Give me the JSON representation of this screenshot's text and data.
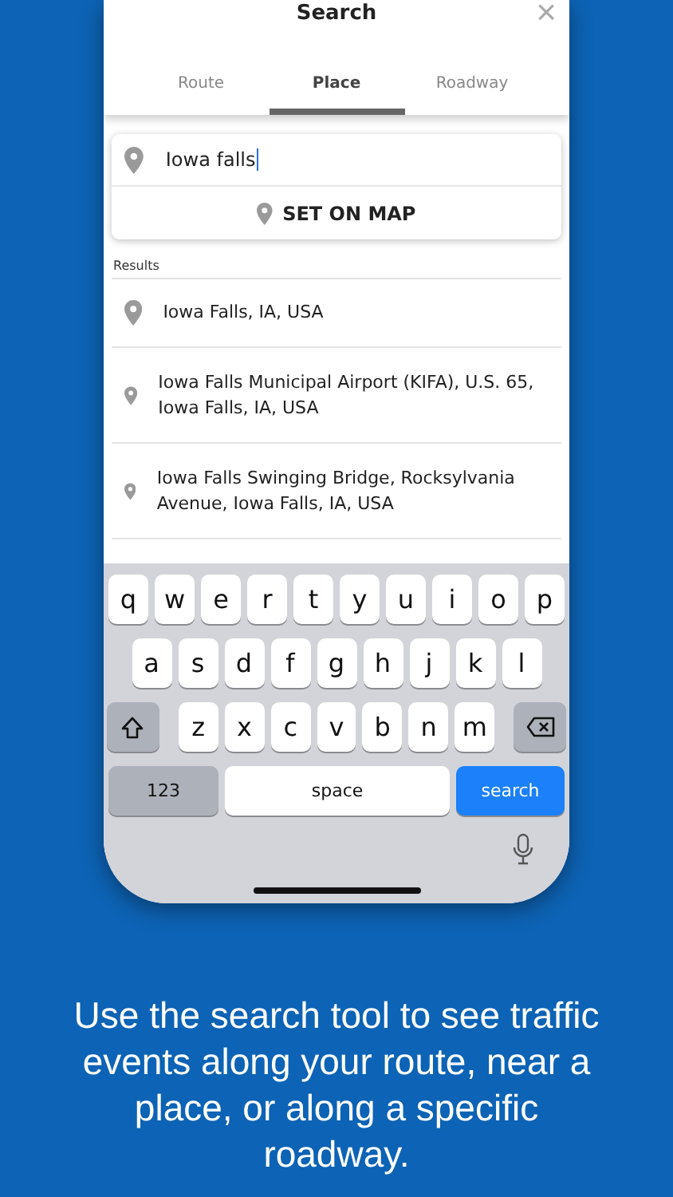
{
  "header": {
    "title": "Search",
    "close": "×"
  },
  "tabs": [
    {
      "label": "Route",
      "selected": false
    },
    {
      "label": "Place",
      "selected": true
    },
    {
      "label": "Roadway",
      "selected": false
    }
  ],
  "search": {
    "value": "Iowa falls"
  },
  "set_on_map": "SET ON MAP",
  "results_label": "Results",
  "results": [
    "Iowa Falls, IA, USA",
    "Iowa Falls Municipal Airport (KIFA), U.S. 65, Iowa Falls, IA, USA",
    "Iowa Falls Swinging Bridge, Rocksylvania Avenue, Iowa Falls, IA, USA"
  ],
  "keyboard": {
    "rows": [
      [
        {
          "kind": "letter",
          "label": "q"
        },
        {
          "kind": "letter",
          "label": "w"
        },
        {
          "kind": "letter",
          "label": "e"
        },
        {
          "kind": "letter",
          "label": "r"
        },
        {
          "kind": "letter",
          "label": "t"
        },
        {
          "kind": "letter",
          "label": "y"
        },
        {
          "kind": "letter",
          "label": "u"
        },
        {
          "kind": "letter",
          "label": "i"
        },
        {
          "kind": "letter",
          "label": "o"
        },
        {
          "kind": "letter",
          "label": "p"
        }
      ],
      [
        {
          "kind": "letter",
          "label": "a"
        },
        {
          "kind": "letter",
          "label": "s"
        },
        {
          "kind": "letter",
          "label": "d"
        },
        {
          "kind": "letter",
          "label": "f"
        },
        {
          "kind": "letter",
          "label": "g"
        },
        {
          "kind": "letter",
          "label": "h"
        },
        {
          "kind": "letter",
          "label": "j"
        },
        {
          "kind": "letter",
          "label": "k"
        },
        {
          "kind": "letter",
          "label": "l"
        }
      ],
      [
        {
          "kind": "shift"
        },
        {
          "kind": "letter",
          "label": "z"
        },
        {
          "kind": "letter",
          "label": "x"
        },
        {
          "kind": "letter",
          "label": "c"
        },
        {
          "kind": "letter",
          "label": "v"
        },
        {
          "kind": "letter",
          "label": "b"
        },
        {
          "kind": "letter",
          "label": "n"
        },
        {
          "kind": "letter",
          "label": "m"
        },
        {
          "kind": "delete"
        }
      ]
    ],
    "bottom_keys": [
      {
        "kind": "mode",
        "label": "123"
      },
      {
        "kind": "space",
        "label": "space"
      },
      {
        "kind": "action",
        "label": "search"
      }
    ]
  },
  "caption": "Use the search tool to see traffic events along your route, near a place, or along a specific roadway."
}
